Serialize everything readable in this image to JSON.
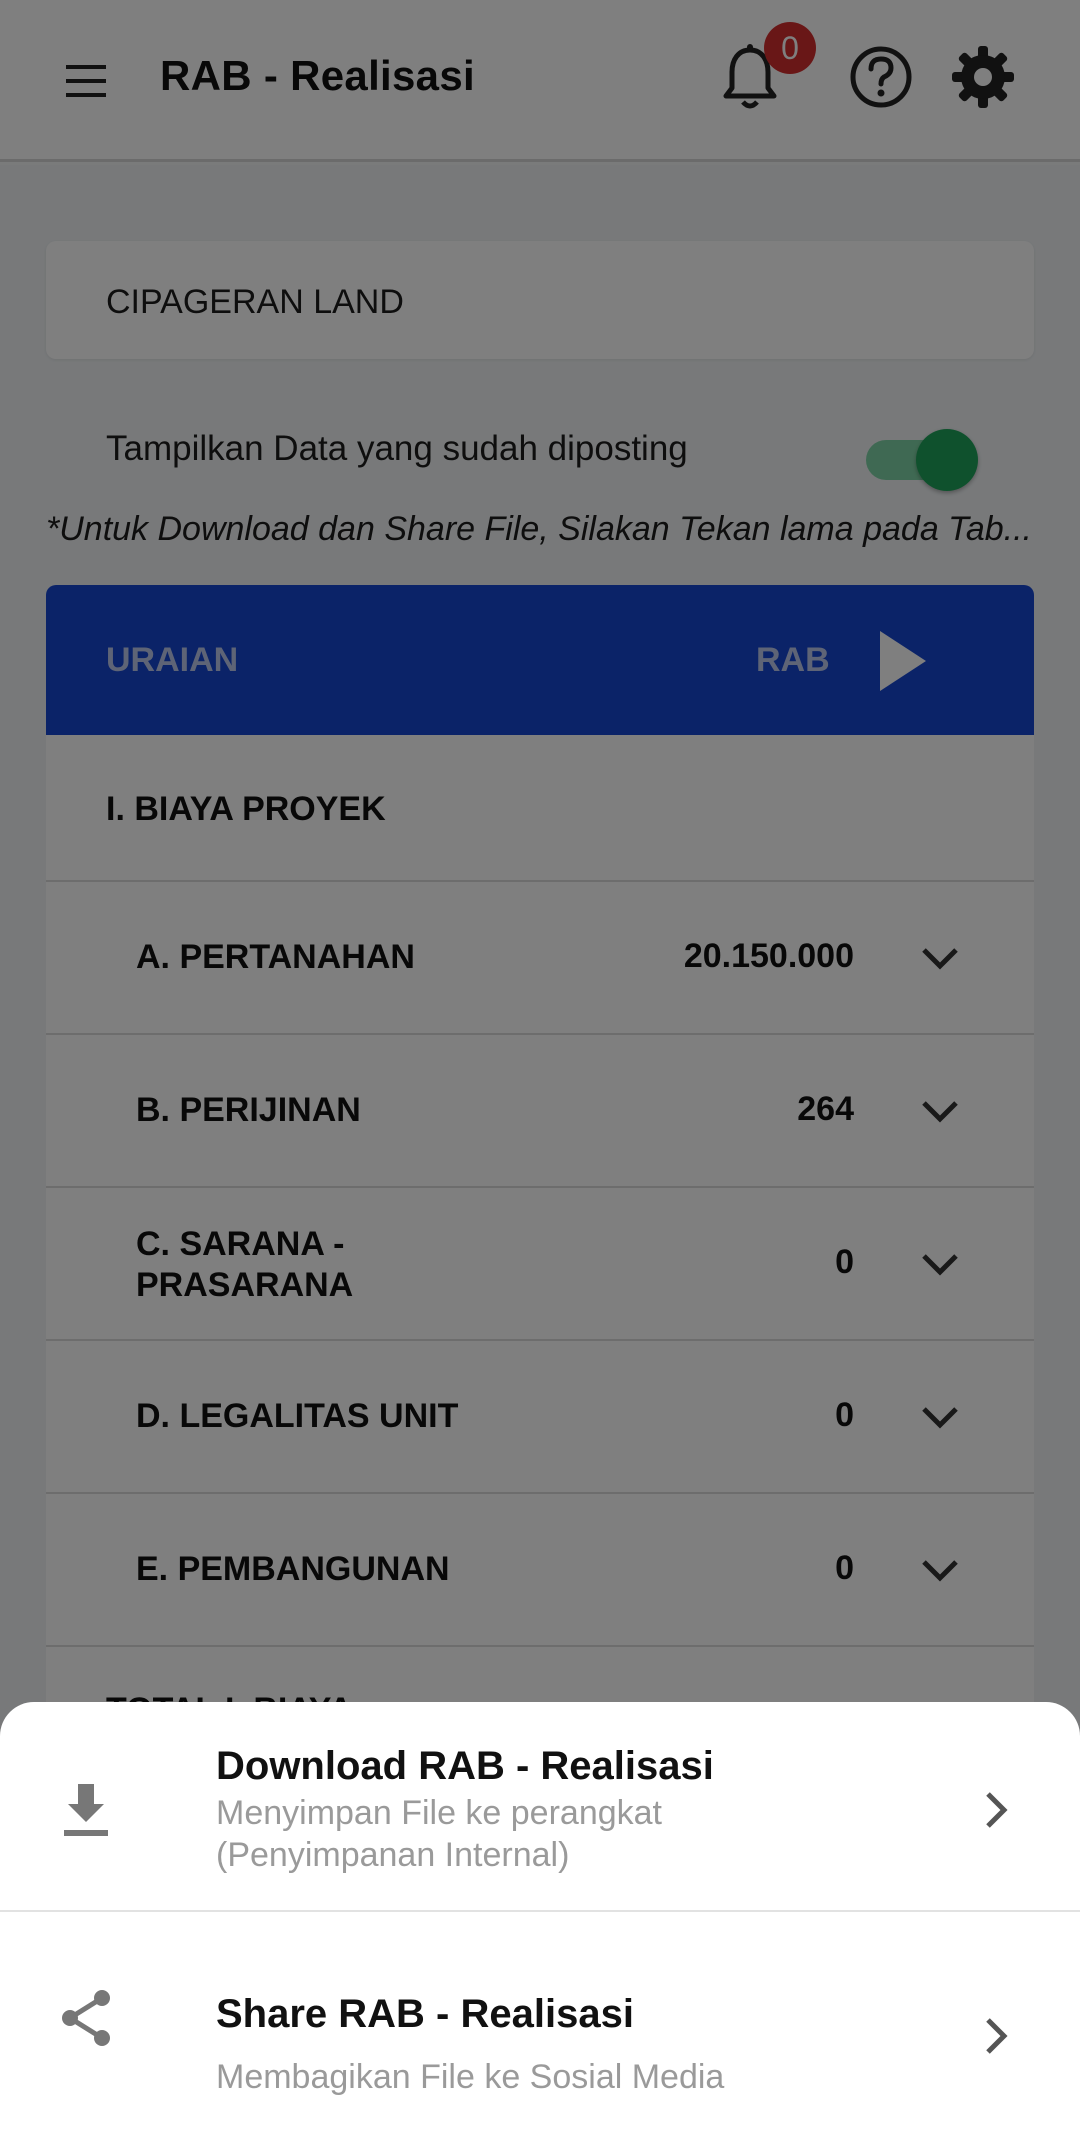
{
  "appbar": {
    "title": "RAB - Realisasi",
    "notification_count": "0"
  },
  "project": {
    "name": "CIPAGERAN LAND"
  },
  "toggle": {
    "label": "Tampilkan Data yang sudah diposting",
    "state": "on"
  },
  "note": "*Untuk Download dan Share File, Silakan Tekan lama pada Tab...",
  "table": {
    "headers": {
      "uraian": "URAIAN",
      "rab": "RAB"
    },
    "section": "I. BIAYA PROYEK",
    "rows": [
      {
        "label": "A. PERTANAHAN",
        "value": "20.150.000"
      },
      {
        "label": "B. PERIJINAN",
        "value": "264"
      },
      {
        "label": "C. SARANA - PRASARANA",
        "value": "0"
      },
      {
        "label": "D. LEGALITAS UNIT",
        "value": "0"
      },
      {
        "label": "E. PEMBANGUNAN",
        "value": "0"
      }
    ],
    "partial_row": "TOTAL I. BIAYA"
  },
  "sheet": {
    "download": {
      "title": "Download RAB - Realisasi",
      "subtitle": "Menyimpan File ke perangkat (Penyimpanan Internal)"
    },
    "share": {
      "title": "Share RAB - Realisasi",
      "subtitle": "Membagikan File ke Sosial Media"
    }
  },
  "colors": {
    "header_blue": "#1646d1",
    "toggle_green": "#1fa35a",
    "badge_red": "#d32f2f"
  }
}
